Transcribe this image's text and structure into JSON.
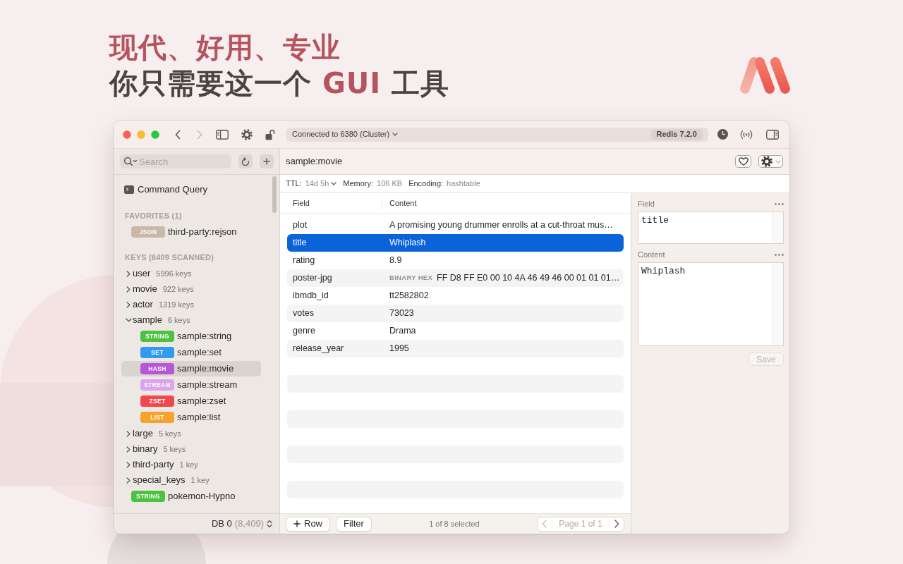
{
  "headline": {
    "line_1": "现代、好用、专业",
    "line_2": [
      {
        "text": "你只需要这一个",
        "accent": false
      },
      {
        "text": "GUI",
        "accent": true
      },
      {
        "text": "工具",
        "accent": false
      }
    ]
  },
  "toolbar": {
    "back": {
      "disabled": false
    },
    "forward": {
      "disabled": true
    },
    "connection": "Connected to 6380 (Cluster)",
    "server_version": "Redis 7.2.0"
  },
  "sidebar": {
    "search": {
      "placeholder": "Search"
    },
    "command_query": "Command Query",
    "favorites": {
      "heading": "FAVORITES (1)",
      "items": [
        {
          "type": "JSON",
          "name": "third-party:rejson",
          "color": "#c9b8a8",
          "selected": false
        }
      ]
    },
    "keys": {
      "heading": "KEYS (8409 SCANNED)",
      "items": [
        {
          "kind": "folder",
          "name": "user",
          "count": "5996 keys",
          "expanded": false
        },
        {
          "kind": "folder",
          "name": "movie",
          "count": "922 keys",
          "expanded": false
        },
        {
          "kind": "folder",
          "name": "actor",
          "count": "1319 keys",
          "expanded": false
        },
        {
          "kind": "folder",
          "name": "sample",
          "count": "6 keys",
          "expanded": true,
          "children": [
            {
              "kind": "key",
              "type": "STRING",
              "name": "sample:string",
              "color": "#4cc23e",
              "selected": false
            },
            {
              "kind": "key",
              "type": "SET",
              "name": "sample:set",
              "color": "#2f9cf0",
              "selected": false
            },
            {
              "kind": "key",
              "type": "HASH",
              "name": "sample:movie",
              "color": "#b657d9",
              "selected": true
            },
            {
              "kind": "key",
              "type": "STREAM",
              "name": "sample:stream",
              "color": "#dba4ec",
              "selected": false
            },
            {
              "kind": "key",
              "type": "ZSET",
              "name": "sample:zset",
              "color": "#f0484c",
              "selected": false
            },
            {
              "kind": "key",
              "type": "LIST",
              "name": "sample:list",
              "color": "#f7a22c",
              "selected": false
            }
          ]
        },
        {
          "kind": "folder",
          "name": "large",
          "count": "5 keys",
          "expanded": false
        },
        {
          "kind": "folder",
          "name": "binary",
          "count": "5 keys",
          "expanded": false
        },
        {
          "kind": "folder",
          "name": "third-party",
          "count": "1 key",
          "expanded": false
        },
        {
          "kind": "folder",
          "name": "special_keys",
          "count": "1 key",
          "expanded": false
        },
        {
          "kind": "key",
          "type": "STRING",
          "name": "pokemon-Hypno",
          "color": "#4cc23e",
          "selected": false
        }
      ]
    },
    "database": {
      "name": "DB 0",
      "count": "(8,409)"
    }
  },
  "key_view": {
    "title": "sample:movie",
    "meta": [
      {
        "label": "TTL:",
        "value": "14d 5h",
        "dropdown": true
      },
      {
        "label": "Memory:",
        "value": "106 KB",
        "dropdown": false
      },
      {
        "label": "Encoding:",
        "value": "hashtable",
        "dropdown": false
      }
    ],
    "table": {
      "columns": [
        "Field",
        "Content"
      ],
      "rows": [
        {
          "field": "plot",
          "content": "A promising young drummer enrolls at a cut-throat mus…",
          "selected": false
        },
        {
          "field": "title",
          "content": "Whiplash",
          "selected": true
        },
        {
          "field": "rating",
          "content": "8.9",
          "selected": false
        },
        {
          "field": "poster-jpg",
          "tag": "BINARY HEX",
          "content": "FF D8 FF E0 00 10 4A 46 49 46 00 01 01 01…",
          "selected": false
        },
        {
          "field": "ibmdb_id",
          "content": "tt2582802",
          "selected": false
        },
        {
          "field": "votes",
          "content": "73023",
          "selected": false
        },
        {
          "field": "genre",
          "content": "Drama",
          "selected": false
        },
        {
          "field": "release_year",
          "content": "1995",
          "selected": false
        }
      ]
    },
    "footer": {
      "add_label": "Row",
      "filter_label": "Filter",
      "selection": "1 of 8 selected",
      "pager": {
        "label": "Page 1 of 1",
        "previous_disabled": true,
        "next_disabled": false
      }
    }
  },
  "inspector": {
    "fields": [
      {
        "label": "Field",
        "value": "title"
      },
      {
        "label": "Content",
        "value": "Whiplash"
      }
    ],
    "save": {
      "label": "Save",
      "disabled": true
    }
  }
}
